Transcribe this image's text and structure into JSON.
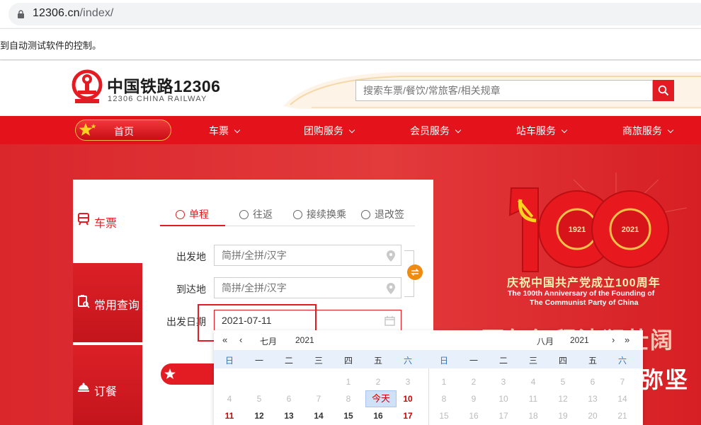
{
  "browser": {
    "url_host": "12306.cn",
    "url_path": "/index/",
    "infobar_text": "到自动测试软件的控制。"
  },
  "header": {
    "logo_cn": "中国铁路12306",
    "logo_en": "12306 CHINA RAILWAY",
    "search_placeholder": "搜索车票/餐饮/常旅客/相关规章"
  },
  "nav": {
    "home": "首页",
    "items": [
      "车票",
      "团购服务",
      "会员服务",
      "站车服务",
      "商旅服务"
    ]
  },
  "hero": {
    "years": [
      "1921",
      "2021"
    ],
    "title": "庆祝中国共产党成立100周年",
    "subtitle_line1": "The 100th Anniversary of the Founding of",
    "subtitle_line2": "The Communist Party of China",
    "slogan1": "百年征程波澜壮阔",
    "slogan2": "弥坚"
  },
  "panel": {
    "side_tabs": [
      "车票",
      "常用查询",
      "订餐"
    ],
    "tabs": [
      "单程",
      "往返",
      "接续换乘",
      "退改签"
    ],
    "from_label": "出发地",
    "to_label": "到达地",
    "date_label": "出发日期",
    "from_placeholder": "简拼/全拼/汉字",
    "to_placeholder": "简拼/全拼/汉字",
    "date_value": "2021-07-11",
    "swap_icon": "swap-icon"
  },
  "calendar": {
    "left_month": "七月",
    "left_year": "2021",
    "right_month": "八月",
    "right_year": "2021",
    "weekdays": [
      "日",
      "一",
      "二",
      "三",
      "四",
      "五",
      "六"
    ],
    "today_label": "今天",
    "left_rows": [
      [
        "",
        "",
        "",
        "",
        "1",
        "2",
        "3"
      ],
      [
        "4",
        "5",
        "6",
        "7",
        "8",
        "",
        "10"
      ],
      [
        "11",
        "12",
        "13",
        "14",
        "15",
        "16",
        "17"
      ]
    ],
    "right_rows": [
      [
        "1",
        "2",
        "3",
        "4",
        "5",
        "6",
        "7"
      ],
      [
        "8",
        "9",
        "10",
        "11",
        "12",
        "13",
        "14"
      ],
      [
        "15",
        "16",
        "17",
        "18",
        "19",
        "20",
        "21"
      ]
    ],
    "colors": {
      "accent": "#e31c23",
      "weekend_header": "#2c73c6",
      "today_bg": "#cfe1f6"
    }
  }
}
